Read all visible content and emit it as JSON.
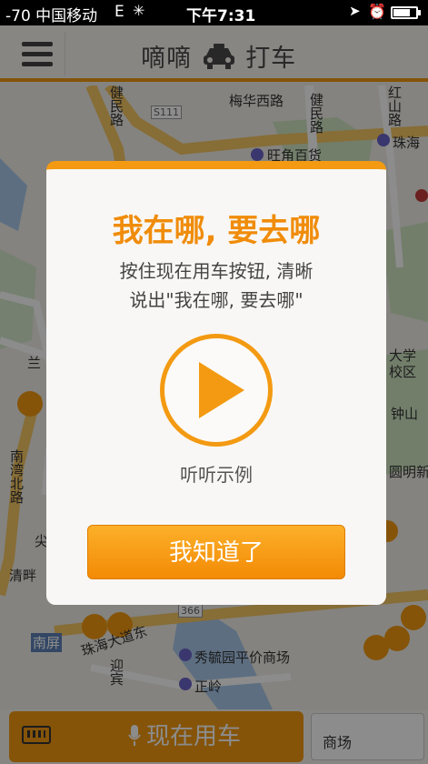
{
  "status_bar": {
    "carrier": "-70 中国移动",
    "network": "E",
    "time": "下午7:31"
  },
  "header": {
    "title_left": "嘀嘀",
    "title_right": "打车",
    "icons": [
      "menu-icon",
      "taxi-icon"
    ]
  },
  "map": {
    "labels": {
      "road_meihua": "梅华西路",
      "road_jianmin": "健民路",
      "road_hongshan": "红山路",
      "poi_wangjiao": "旺角百货",
      "poi_zhuhai": "珠海",
      "district_lan": "兰",
      "district_daxue": "大学",
      "district_xiaoqu": "校区",
      "road_nanwan": "南湾北路",
      "poi_zhongshan": "钟山",
      "poi_yuanming": "圆明新",
      "poi_jian": "尖",
      "poi_qingpan": "清畔",
      "district_nanping": "南屏",
      "road_zhuhai": "珠海大道东",
      "poi_xiuyuan": "秀毓园平价商场",
      "poi_zhengling": "正岭",
      "road_yingbin": "迎宾",
      "road_shan": "山",
      "road_code_s111": "S111",
      "road_code_366": "366"
    }
  },
  "dialog": {
    "title": "我在哪, 要去哪",
    "line1": "按住现在用车按钮, 清晰",
    "line2": "说出\"我在哪, 要去哪\"",
    "example_label": "听听示例",
    "confirm_label": "我知道了",
    "accent_color": "#f39a12"
  },
  "bottom_bar": {
    "voice_button_label": "现在用车",
    "destination_text": "商场",
    "icons": [
      "keyboard-icon",
      "mic-icon"
    ]
  }
}
